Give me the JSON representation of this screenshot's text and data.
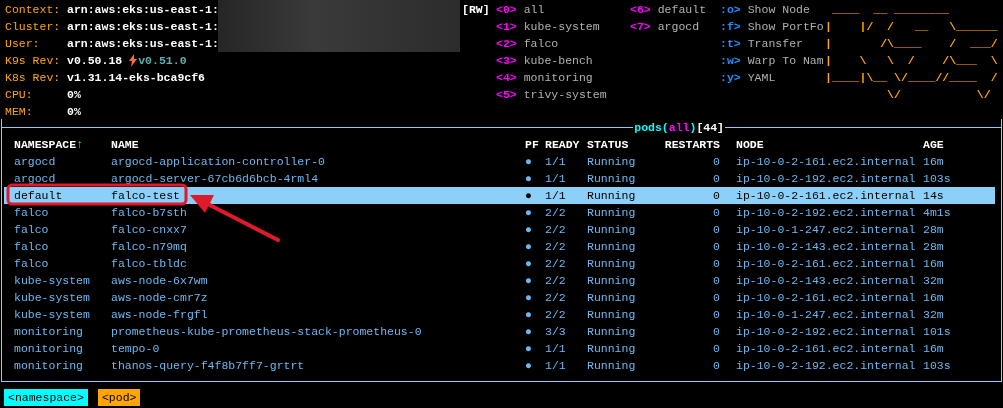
{
  "info": [
    {
      "label": "Context:",
      "value": "arn:aws:eks:us-east-1:"
    },
    {
      "label": "Cluster:",
      "value": "arn:aws:eks:us-east-1:"
    },
    {
      "label": "User:",
      "value": "arn:aws:eks:us-east-1:"
    },
    {
      "label": "K9s Rev:",
      "value": "v0.50.18",
      "update": "v0.51.0"
    },
    {
      "label": "K8s Rev:",
      "value": "v1.31.14-eks-bca9cf6"
    },
    {
      "label": "CPU:",
      "value": "0%"
    },
    {
      "label": "MEM:",
      "value": "0%"
    }
  ],
  "mode": "[RW]",
  "namespaces": [
    {
      "key": "<0>",
      "name": "all"
    },
    {
      "key": "<1>",
      "name": "kube-system"
    },
    {
      "key": "<2>",
      "name": "falco"
    },
    {
      "key": "<3>",
      "name": "kube-bench"
    },
    {
      "key": "<4>",
      "name": "monitoring"
    },
    {
      "key": "<5>",
      "name": "trivy-system"
    },
    {
      "key": "<6>",
      "name": "default"
    },
    {
      "key": "<7>",
      "name": "argocd"
    }
  ],
  "hotkeys": [
    {
      "key": ":o>",
      "label": "Show Node"
    },
    {
      "key": ":f>",
      "label": "Show PortFo"
    },
    {
      "key": ":t>",
      "label": "Transfer"
    },
    {
      "key": ":w>",
      "label": "Warp To Nam"
    },
    {
      "key": ":y>",
      "label": "YAML"
    }
  ],
  "logo": [
    " ____  __ ________",
    "|    |/  /   __   \\______",
    "|       /\\____    /  ___/",
    "|    \\   \\  /    /\\___  \\",
    "|____|\\__ \\/____//____  /",
    "         \\/           \\/"
  ],
  "table": {
    "title": [
      {
        "text": "pods(",
        "kind": "resource"
      },
      {
        "text": "all",
        "kind": "filter"
      },
      {
        "text": ")",
        "kind": "resource"
      },
      {
        "text": "[44]",
        "kind": "count"
      }
    ],
    "columns": [
      {
        "label": "NAMESPACE",
        "sort": "↑"
      },
      {
        "label": "NAME"
      },
      {
        "label": "PF"
      },
      {
        "label": "READY"
      },
      {
        "label": "STATUS"
      },
      {
        "label": "RESTARTS"
      },
      {
        "label": "NODE"
      },
      {
        "label": "AGE"
      }
    ],
    "rows": [
      {
        "namespace": "argocd",
        "name": "argocd-application-controller-0",
        "pf": "●",
        "ready": "1/1",
        "status": "Running",
        "restarts": "0",
        "node": "ip-10-0-2-161.ec2.internal",
        "age": "16m",
        "selected": false
      },
      {
        "namespace": "argocd",
        "name": "argocd-server-67cb6d6bcb-4rml4",
        "pf": "●",
        "ready": "1/1",
        "status": "Running",
        "restarts": "0",
        "node": "ip-10-0-2-192.ec2.internal",
        "age": "103s",
        "selected": false
      },
      {
        "namespace": "default",
        "name": "falco-test",
        "pf": "●",
        "ready": "1/1",
        "status": "Running",
        "restarts": "0",
        "node": "ip-10-0-2-161.ec2.internal",
        "age": "14s",
        "selected": true
      },
      {
        "namespace": "falco",
        "name": "falco-b7sth",
        "pf": "●",
        "ready": "2/2",
        "status": "Running",
        "restarts": "0",
        "node": "ip-10-0-2-192.ec2.internal",
        "age": "4m1s",
        "selected": false
      },
      {
        "namespace": "falco",
        "name": "falco-cnxx7",
        "pf": "●",
        "ready": "2/2",
        "status": "Running",
        "restarts": "0",
        "node": "ip-10-0-1-247.ec2.internal",
        "age": "28m",
        "selected": false
      },
      {
        "namespace": "falco",
        "name": "falco-n79mq",
        "pf": "●",
        "ready": "2/2",
        "status": "Running",
        "restarts": "0",
        "node": "ip-10-0-2-143.ec2.internal",
        "age": "28m",
        "selected": false
      },
      {
        "namespace": "falco",
        "name": "falco-tbldc",
        "pf": "●",
        "ready": "2/2",
        "status": "Running",
        "restarts": "0",
        "node": "ip-10-0-2-161.ec2.internal",
        "age": "16m",
        "selected": false
      },
      {
        "namespace": "kube-system",
        "name": "aws-node-6x7wm",
        "pf": "●",
        "ready": "2/2",
        "status": "Running",
        "restarts": "0",
        "node": "ip-10-0-2-143.ec2.internal",
        "age": "32m",
        "selected": false
      },
      {
        "namespace": "kube-system",
        "name": "aws-node-cmr7z",
        "pf": "●",
        "ready": "2/2",
        "status": "Running",
        "restarts": "0",
        "node": "ip-10-0-2-161.ec2.internal",
        "age": "16m",
        "selected": false
      },
      {
        "namespace": "kube-system",
        "name": "aws-node-frgfl",
        "pf": "●",
        "ready": "2/2",
        "status": "Running",
        "restarts": "0",
        "node": "ip-10-0-1-247.ec2.internal",
        "age": "32m",
        "selected": false
      },
      {
        "namespace": "monitoring",
        "name": "prometheus-kube-prometheus-stack-prometheus-0",
        "pf": "●",
        "ready": "3/3",
        "status": "Running",
        "restarts": "0",
        "node": "ip-10-0-2-192.ec2.internal",
        "age": "101s",
        "selected": false
      },
      {
        "namespace": "monitoring",
        "name": "tempo-0",
        "pf": "●",
        "ready": "1/1",
        "status": "Running",
        "restarts": "0",
        "node": "ip-10-0-2-161.ec2.internal",
        "age": "16m",
        "selected": false
      },
      {
        "namespace": "monitoring",
        "name": "thanos-query-f4f8b7ff7-grtrt",
        "pf": "●",
        "ready": "1/1",
        "status": "Running",
        "restarts": "0",
        "node": "ip-10-0-2-192.ec2.internal",
        "age": "103s",
        "selected": false
      }
    ]
  },
  "breadcrumbs": [
    {
      "label": "<namespace>",
      "color": "#00ffff"
    },
    {
      "label": "<pod>",
      "color": "#ffa500"
    }
  ]
}
